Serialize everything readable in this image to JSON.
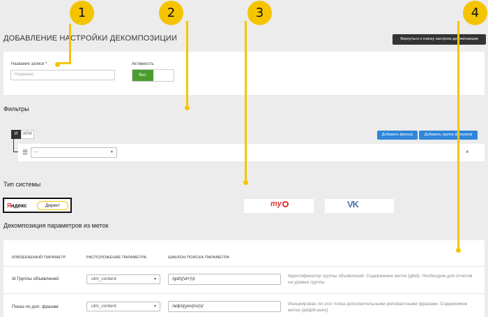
{
  "header": {
    "title": "ДОБАВЛЕНИЕ НАСТРОЙКИ ДЕКОМПОЗИЦИИ",
    "back_button": "Вернуться к списку настроек декомпозиции"
  },
  "record": {
    "name_label": "Название записи *",
    "name_placeholder": "Название..",
    "active_label": "Активность",
    "toggle_on_label": "Вкл."
  },
  "filters": {
    "title": "Фильтры",
    "logic_and": "И",
    "logic_or": "ИЛИ",
    "add_filter": "Добавить фильтр",
    "add_group": "Добавить группу фильтров",
    "filter_select_value": "---",
    "remove_icon": "×"
  },
  "system": {
    "title": "Тип системы",
    "yandex_word_red": "Я",
    "yandex_word_rest": "ндекс",
    "yandex_pill": "Директ",
    "mytarget_logo": "my",
    "vk_logo": "VK"
  },
  "decomposition": {
    "title": "Декомпозиция параметров из меток",
    "columns": [
      "ИЗВЛЕКАЕМЫЙ ПАРАМЕТР",
      "РАСПОЛОЖЕНИЕ ПАРАМЕТРА",
      "ШАБЛОН ПОИСКА ПАРАМЕТРА"
    ],
    "rows": [
      {
        "param": "Id Группы объявлений",
        "location": "utm_content",
        "pattern": "/gid\\|(\\d+)\\|/",
        "description": "Идентификатор группы объявлений. Содержимое метки {gbid}. Необходим для отчетов на уровне группы"
      },
      {
        "param": "Показ по доп. фразам",
        "location": "utm_content",
        "pattern": "/adp\\|(yes|no)\\|/",
        "description": "Инициирован ли этот показ дополнительными релевантными фразами. Содержимое метки {addphrases}"
      }
    ]
  },
  "callouts": [
    "1",
    "2",
    "3",
    "4"
  ],
  "colors": {
    "callout": "#f5c400",
    "toggle_on": "#4a9c2e",
    "primary_button": "#2f86d9",
    "yandex_red": "#e41e20",
    "mytarget_red": "#e03030",
    "vk_blue": "#4a76a8"
  }
}
